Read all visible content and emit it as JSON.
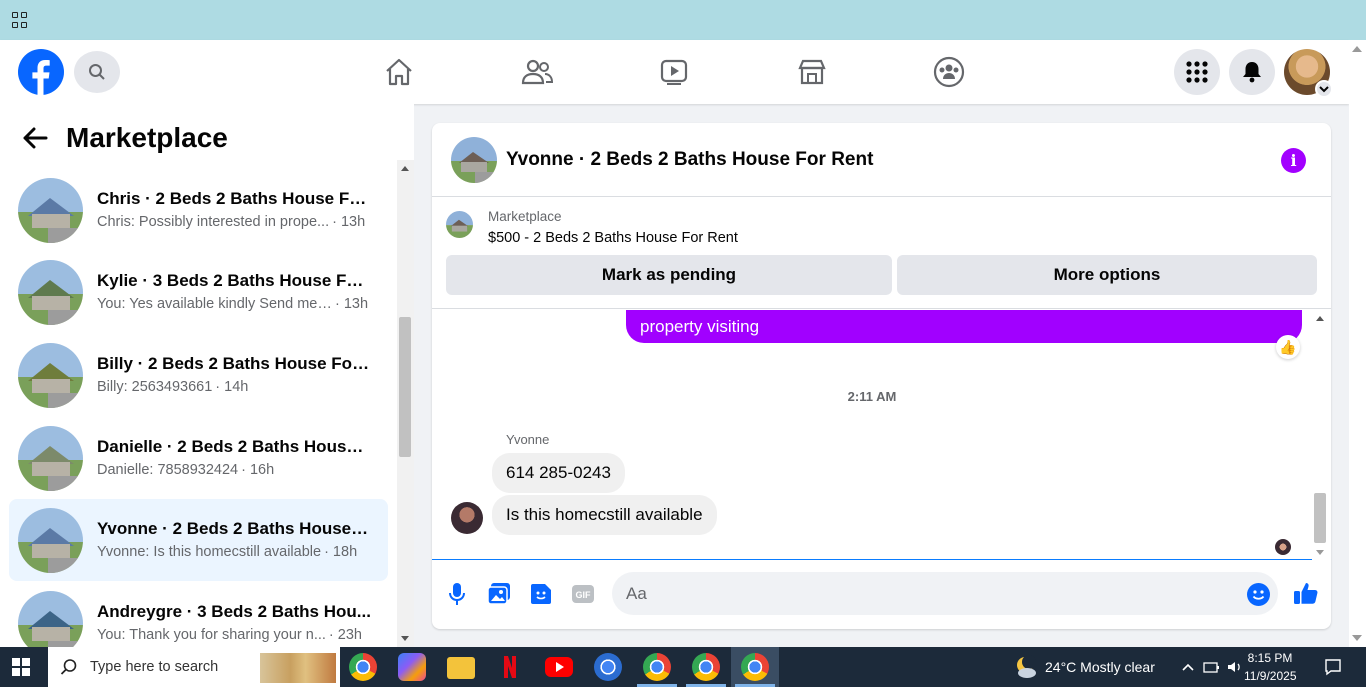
{
  "topnav": {
    "search_label": "Search Facebook",
    "nav_items": [
      "home",
      "friends",
      "watch",
      "marketplace",
      "groups"
    ]
  },
  "sidebar": {
    "title": "Marketplace",
    "conversations": [
      {
        "name": "Chris · 2 Beds 2 Baths House For...",
        "preview": "Chris: Possibly interested in prope...",
        "time": "· 13h",
        "active": false,
        "thumb_color": "#5b7aa6"
      },
      {
        "name": "Kylie · 3 Beds 2 Baths House For ...",
        "preview": "You: Yes available kindly Send me ...",
        "time": "· 13h",
        "active": false,
        "thumb_color": "#5f7a4e"
      },
      {
        "name": "Billy · 2 Beds 2 Baths House For ...",
        "preview": "Billy: 2563493661",
        "time": "· 14h",
        "active": false,
        "thumb_color": "#6f7d3c"
      },
      {
        "name": "Danielle · 2 Beds 2 Baths Houses...",
        "preview": "Danielle: 7858932424",
        "time": "· 16h",
        "active": false,
        "thumb_color": "#7c8a6a"
      },
      {
        "name": "Yvonne · 2 Beds 2 Baths House F...",
        "preview": "Yvonne: Is this homecstill available",
        "time": "· 18h",
        "active": true,
        "thumb_color": "#5b7aa6"
      },
      {
        "name": "Andreygre · 3 Beds 2 Baths Hou...",
        "preview": "You: Thank you for sharing your n...",
        "time": "· 23h",
        "active": false,
        "thumb_color": "#3c6487"
      }
    ]
  },
  "chat": {
    "title": "Yvonne · 2 Beds 2 Baths House For Rent",
    "info_glyph": "i",
    "listing_source": "Marketplace",
    "listing_price": "$500 - 2 Beds 2 Baths House For Rent",
    "mark_pending_label": "Mark as pending",
    "more_options_label": "More options",
    "outgoing_partial": "property visiting",
    "reaction": "👍",
    "timestamp": "2:11 AM",
    "sender_name": "Yvonne",
    "incoming": [
      "614 285-0243",
      "Is this homecstill available"
    ],
    "input_placeholder": "Aa",
    "accent_color": "#a100ff",
    "brand_color": "#0866ff"
  },
  "taskbar": {
    "search_placeholder": "Type here to search",
    "weather": "24°C  Mostly clear",
    "time": "8:15 PM",
    "date": "11/9/2025"
  }
}
